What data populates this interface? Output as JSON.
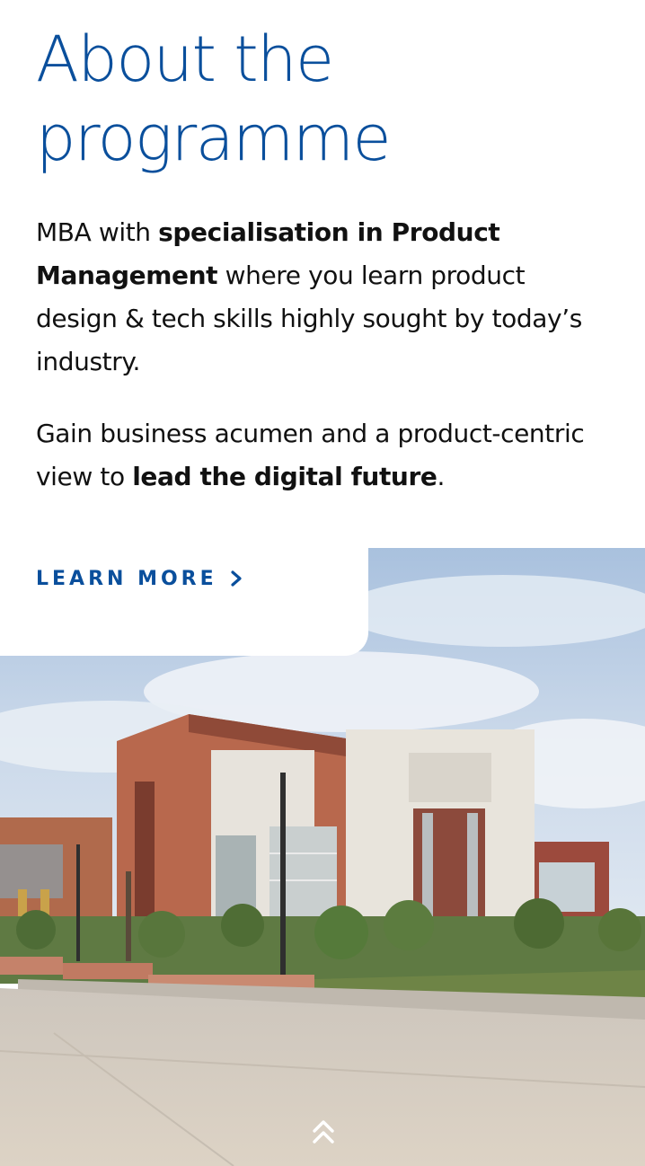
{
  "section": {
    "title_line1": "About the",
    "title_line2": "programme"
  },
  "paragraph1": {
    "t1": "MBA with ",
    "b1": "specialisation in Product Management",
    "t2": " where you learn product design & tech skills highly sought by today’s industry."
  },
  "paragraph2": {
    "t1": "Gain business acumen and a product-centric view to ",
    "b1": "lead the digital future",
    "t2": "."
  },
  "cta": {
    "label": "LEARN MORE",
    "icon": "chevron-right-icon"
  },
  "scroll_top": {
    "icon": "double-chevron-up-icon"
  },
  "colors": {
    "brand_blue": "#0a4f9c",
    "text": "#111111"
  }
}
